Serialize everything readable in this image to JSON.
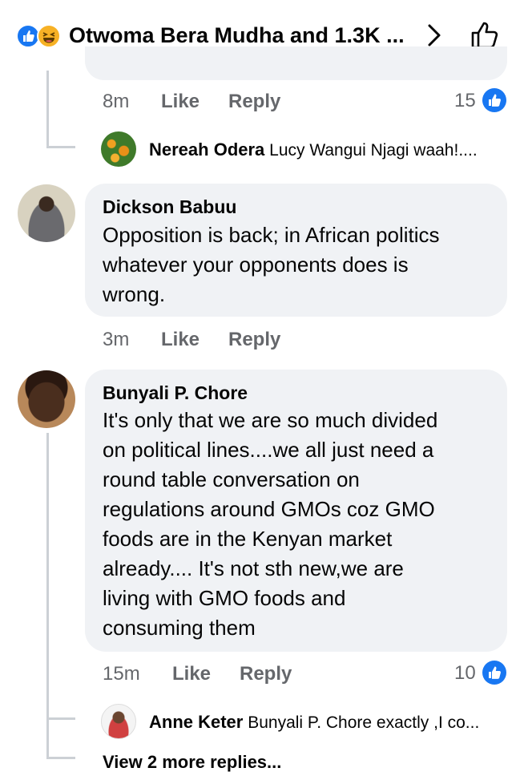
{
  "header": {
    "title": "Otwoma Bera Mudha and 1.3K ...",
    "reaction_icons": [
      "like-icon",
      "haha-icon"
    ],
    "accent": "#1877f2"
  },
  "prev_comment": {
    "time": "8m",
    "like_label": "Like",
    "reply_label": "Reply",
    "reaction_count": "15",
    "reply_preview": {
      "author": "Nereah Odera",
      "text": "Lucy Wangui Njagi waah!...."
    }
  },
  "comments": [
    {
      "author": "Dickson Babuu",
      "lines": [
        "Opposition is back; in African politics",
        "whatever your opponents does is",
        "wrong."
      ],
      "time": "3m",
      "like_label": "Like",
      "reply_label": "Reply"
    },
    {
      "author": "Bunyali P. Chore",
      "lines": [
        "It's only that we are so much divided",
        "on political lines....we all just need a",
        "round table conversation on",
        "regulations around GMOs coz GMO",
        "foods are in the Kenyan market",
        "already.... It's not sth new,we are",
        "living with GMO foods and",
        "consuming them"
      ],
      "time": "15m",
      "like_label": "Like",
      "reply_label": "Reply",
      "reaction_count": "10",
      "reply_preview": {
        "author": "Anne Keter",
        "text": "Bunyali P. Chore exactly ,I co..."
      },
      "more_replies": "View 2 more replies..."
    }
  ]
}
